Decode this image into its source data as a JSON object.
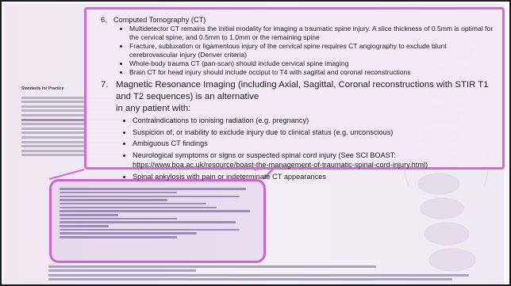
{
  "document": {
    "title": "Standards for Practice"
  },
  "zoom": {
    "sections": [
      {
        "num": "6.",
        "title": "Computed Tomography (CT)",
        "bullets": [
          "Multidetector CT remains the initial modality for imaging a traumatic spine injury. A slice thickness of 0.5mm is optimal for the cervical spine, and 0.5mm to 1.0mm or the remaining spine",
          "Fracture, subluxation or ligamentous injury of the cervical spine requires CT angiography to exclude blunt cerebrovascular injury (Denver criteria)",
          "Whole-body trauma CT (pan-scan) should include cervical spine imaging",
          "Brain CT for head injury should include occiput to T4 with sagittal and coronal reconstructions"
        ]
      },
      {
        "num": "7.",
        "title": "Magnetic Resonance Imaging (including Axial, Sagittal, Coronal reconstructions with STIR T1 and T2 sequences) is an alternative",
        "continuation": "in any patient with:",
        "bullets": [
          "Contraindications to ionising radiation (e.g. pregnancy)",
          "Suspicion of, or inability to exclude injury due to clinical status (e.g. unconscious)",
          "Ambiguous CT findings",
          "Neurological symptoms or signs or suspected spinal cord injury (See SCI BOAST: https://www.boa.ac.uk/resource/boast-the-management-of-traumatic-spinal-cord-injury.html)",
          "Spinal ankylosis with pain or indeterminate CT appearances"
        ]
      }
    ]
  },
  "colors": {
    "highlight_border": "#cd63d2",
    "zoom_border": "#d06ad4",
    "page_background": "#efe6f0"
  }
}
